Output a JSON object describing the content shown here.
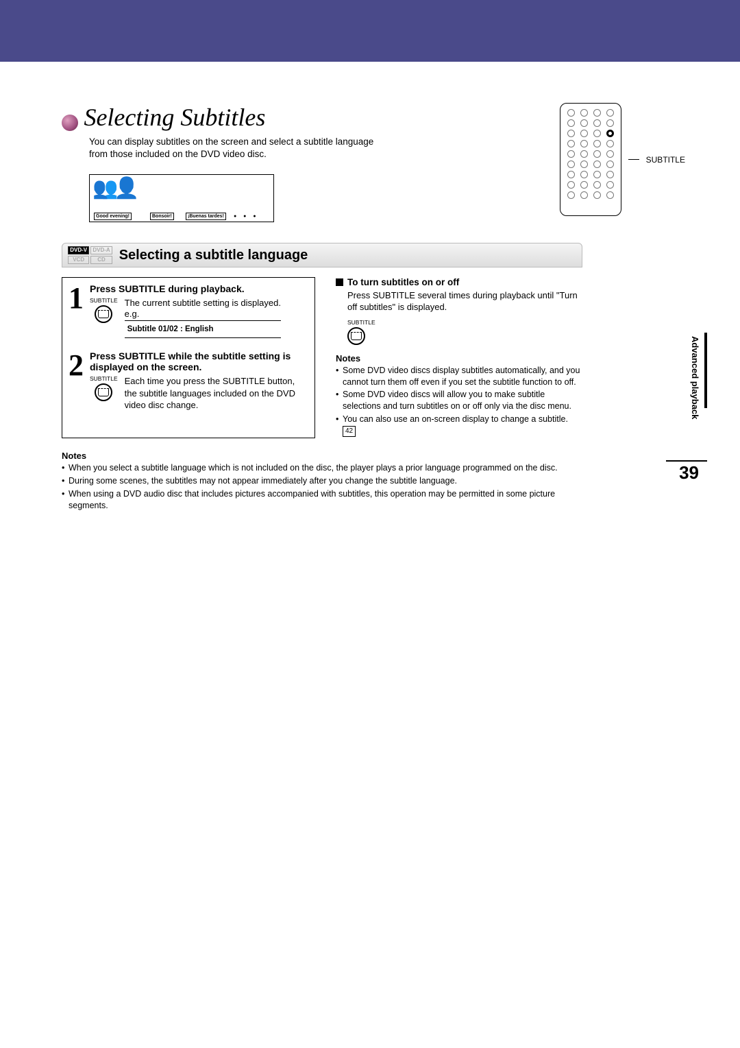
{
  "header": {
    "title": "Selecting Subtitles",
    "intro": "You can display subtitles on the screen and select a subtitle language from those included on the DVD video disc."
  },
  "illustration": {
    "bubble1": "Good evening!",
    "bubble2": "Bonsoir!",
    "bubble3": "¡Buenas tardes!"
  },
  "remote": {
    "label": "SUBTITLE"
  },
  "section": {
    "badges": {
      "dvdv": "DVD-V",
      "dvda": "DVD-A",
      "vcd": "VCD",
      "cd": "CD"
    },
    "title": "Selecting a subtitle language"
  },
  "steps": [
    {
      "num": "1",
      "title": "Press SUBTITLE during playback.",
      "icon_label": "SUBTITLE",
      "desc": "The current subtitle setting is displayed.",
      "eg": "e.g.",
      "osd": "Subtitle  01/02 :  English"
    },
    {
      "num": "2",
      "title": "Press SUBTITLE while the subtitle setting is displayed on the screen.",
      "icon_label": "SUBTITLE",
      "desc": "Each time you press the SUBTITLE button, the subtitle languages included on the DVD video disc change."
    }
  ],
  "right": {
    "heading": "To turn subtitles on or off",
    "desc": "Press SUBTITLE several times during playback until \"Turn off subtitles\" is displayed.",
    "icon_label": "SUBTITLE",
    "notes_head": "Notes",
    "notes": [
      "Some DVD video discs display subtitles automatically, and you cannot turn them off even if you set the subtitle function to off.",
      "Some DVD video discs will allow you to make subtitle selections and turn subtitles on or off only via the disc menu.",
      "You can also use an on-screen display to change a subtitle."
    ],
    "ref": "42"
  },
  "bottom": {
    "notes_head": "Notes",
    "notes": [
      "When you select a subtitle language which is not included on the disc, the player plays a prior language programmed on the disc.",
      "During some scenes, the subtitles may not appear immediately after you change the subtitle language.",
      "When using a DVD audio disc that includes pictures accompanied with subtitles, this operation may be permitted in some picture segments."
    ]
  },
  "side": {
    "label": "Advanced playback"
  },
  "page_number": "39"
}
